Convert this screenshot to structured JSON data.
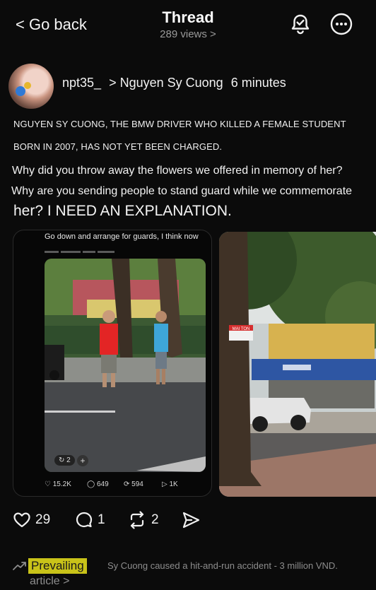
{
  "header": {
    "back_label": "< Go back",
    "title": "Thread",
    "views": "289 views >"
  },
  "post": {
    "author": "npt35_",
    "reply_to": "> Nguyen Sy Cuong",
    "time": "6 minutes",
    "lines": {
      "caps1": "NGUYEN SY CUONG, THE BMW DRIVER WHO KILLED A FEMALE STUDENT",
      "caps2": "BORN IN 2007, HAS NOT YET BEEN CHARGED.",
      "line3": "Why did you throw away the flowers we offered in memory of her?",
      "line4": "Why are you sending people to stand guard while we commemorate",
      "line5": "her? I NEED AN EXPLANATION."
    },
    "embed": {
      "text": "Go down and arrange for guards, I think now",
      "repost_badge": "2",
      "stats": {
        "likes": "15.2K",
        "comments": "649",
        "reposts": "594",
        "shares": "1K"
      }
    },
    "actions": {
      "likes": "29",
      "comments": "1",
      "reposts": "2"
    }
  },
  "footer": {
    "prevailing_label": "Prevailing",
    "trend_text": "Sy Cuong caused a hit-and-run accident - 3 million VND.",
    "article_label": "article >"
  },
  "photo_sign": "MAI TON",
  "icons": [
    "back-icon",
    "bell-check-icon",
    "more-icon",
    "heart-icon",
    "comment-icon",
    "repost-icon",
    "share-icon",
    "trending-icon"
  ],
  "colors": {
    "background": "#0b0b0b",
    "highlight": "#c9c319",
    "muted": "#8d8d8d"
  }
}
